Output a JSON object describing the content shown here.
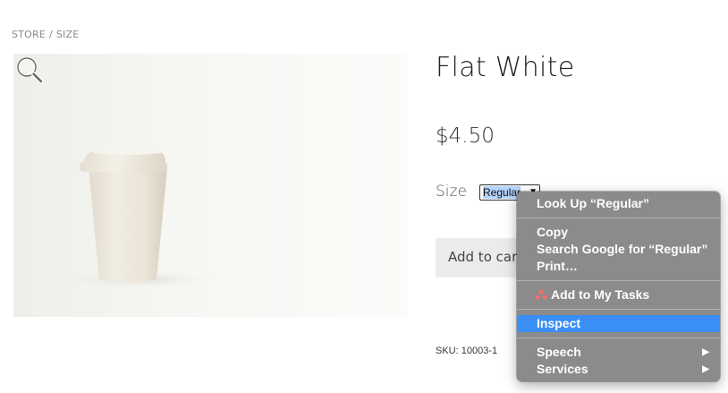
{
  "breadcrumb": {
    "store": "STORE",
    "sep": "/",
    "current": "SIZE"
  },
  "product": {
    "title": "Flat White",
    "price": "$4.50",
    "size_label": "Size",
    "size_selected": "Regular",
    "add_to_cart": "Add to cart",
    "sku": "SKU: 10003-1"
  },
  "context_menu": {
    "items": [
      {
        "label": "Look Up “Regular”"
      },
      {
        "label": "Copy"
      },
      {
        "label": "Search Google for “Regular”"
      },
      {
        "label": "Print…"
      },
      {
        "label": "Add to My Tasks",
        "icon": "asana-icon"
      },
      {
        "label": "Inspect",
        "highlighted": true
      },
      {
        "label": "Speech",
        "submenu": true
      },
      {
        "label": "Services",
        "submenu": true
      }
    ]
  },
  "icons": {
    "zoom": "magnifier-icon",
    "submenu": "submenu-arrow-icon",
    "task": "asana-icon"
  },
  "colors": {
    "menu_bg": "#8b8b8b",
    "menu_highlight": "#3a8ef6",
    "button_bg": "#ebebeb",
    "selection": "#b3d4fc"
  }
}
